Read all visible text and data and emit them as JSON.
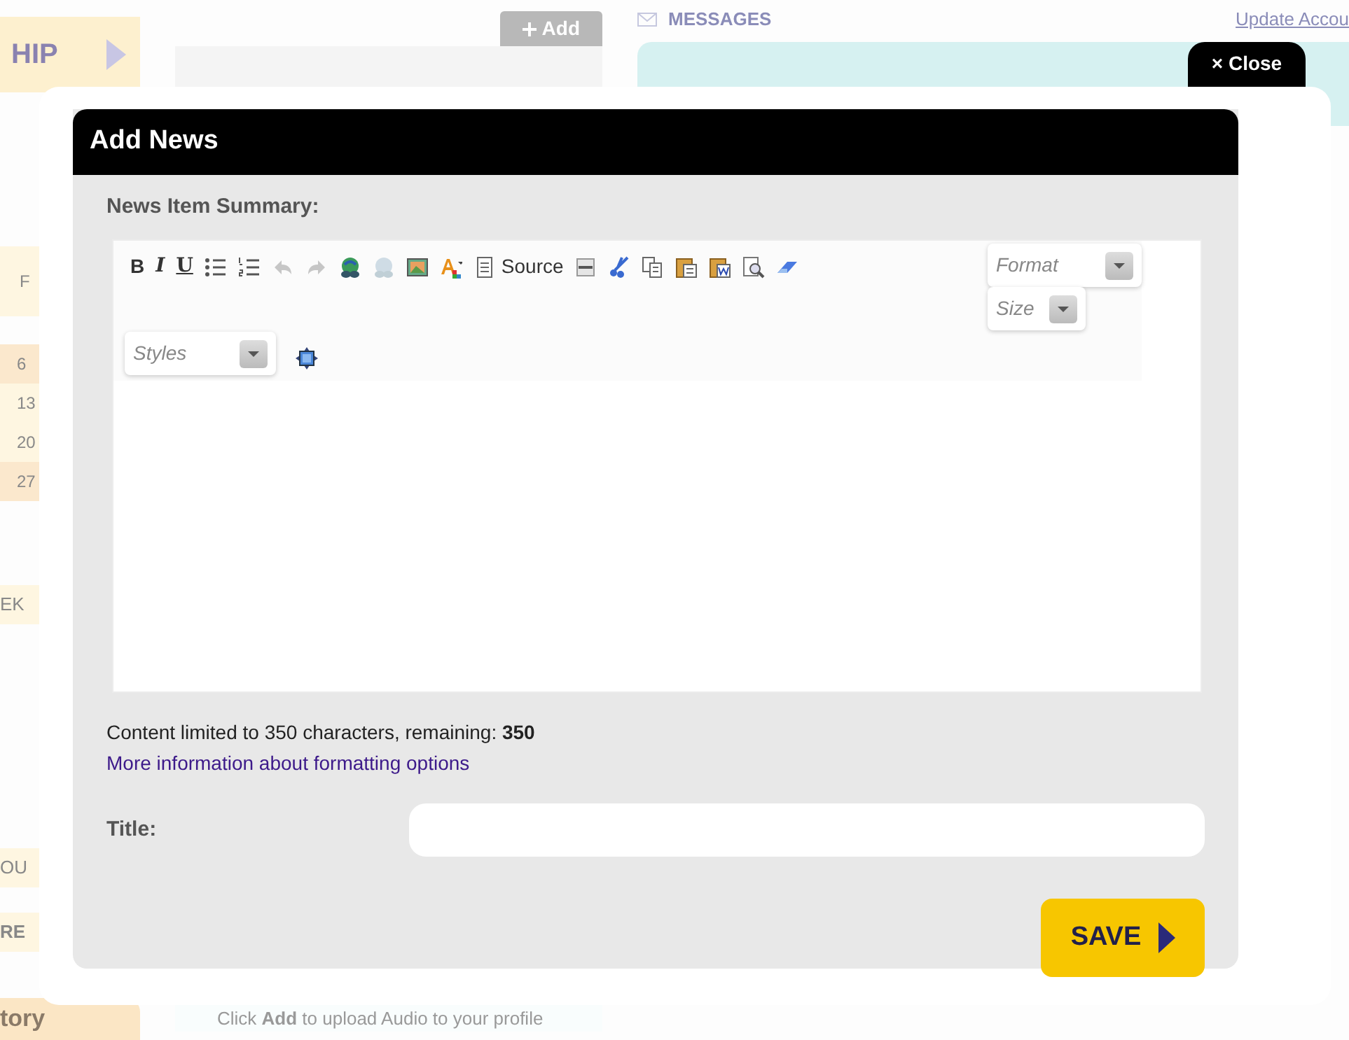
{
  "background": {
    "side_tab": "HIP",
    "calendar": {
      "day_header": "F",
      "days": [
        {
          "label": "6",
          "highlighted": true
        },
        {
          "label": "13",
          "highlighted": false
        },
        {
          "label": "20",
          "highlighted": false
        },
        {
          "label": "27",
          "highlighted": true
        }
      ]
    },
    "side_labels": [
      "EK",
      "OU",
      "RE"
    ],
    "bottom_tab": "tory",
    "add_button": "Add",
    "messages_link": "MESSAGES",
    "account_link": "Update Accou",
    "audio_hint": "Click **Add** to upload Audio to your profile"
  },
  "dialog": {
    "close_label": "Close",
    "close_icon": "×",
    "title": "Add News",
    "summary_label": "News Item Summary:",
    "toolbar": [
      {
        "kind": "button",
        "label": "B",
        "disabled": false
      },
      {
        "kind": "button",
        "label": "I",
        "disabled": false
      },
      {
        "kind": "button",
        "label": "U",
        "disabled": false
      },
      {
        "kind": "icon",
        "disabled": false
      },
      {
        "kind": "icon",
        "disabled": false
      },
      {
        "kind": "icon",
        "disabled": true
      },
      {
        "kind": "icon",
        "disabled": true
      },
      {
        "kind": "icon",
        "disabled": false
      },
      {
        "kind": "icon",
        "disabled": true
      },
      {
        "kind": "icon",
        "disabled": false
      },
      {
        "kind": "icon",
        "disabled": false
      },
      {
        "kind": "icon",
        "label": "Source",
        "disabled": false
      },
      {
        "kind": "icon",
        "disabled": false
      },
      {
        "kind": "icon",
        "disabled": false
      },
      {
        "kind": "icon",
        "disabled": false
      },
      {
        "kind": "icon",
        "disabled": false
      },
      {
        "kind": "icon",
        "disabled": false
      },
      {
        "kind": "icon",
        "disabled": false
      },
      {
        "kind": "icon",
        "disabled": false
      },
      {
        "kind": "dropdown",
        "label": "Format"
      },
      {
        "kind": "dropdown",
        "label": "Size"
      },
      {
        "kind": "dropdown",
        "label": "Styles"
      },
      {
        "kind": "icon",
        "disabled": false
      }
    ],
    "limit_note": "Content limited to 350 characters, remaining: **350**",
    "help_link": "More information about formatting options",
    "title_label": "Title:",
    "save_label": "SAVE"
  }
}
